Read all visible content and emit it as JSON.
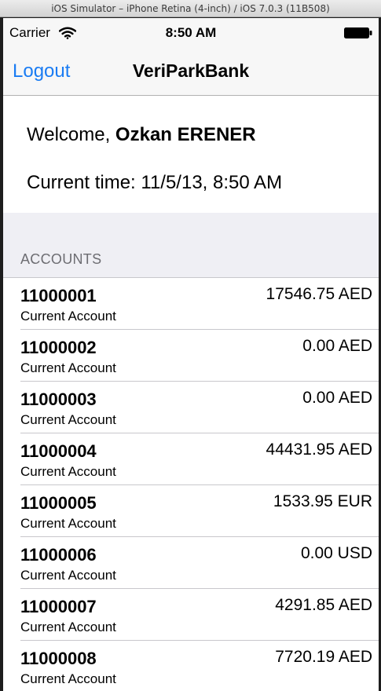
{
  "window": {
    "title": "iOS Simulator – iPhone Retina (4-inch) / iOS 7.0.3 (11B508)"
  },
  "status_bar": {
    "carrier": "Carrier",
    "wifi_icon": "wifi-icon",
    "time": "8:50 AM",
    "battery_icon": "battery-icon"
  },
  "nav": {
    "left_button": "Logout",
    "title": "VeriParkBank",
    "accent_color": "#1a7cf3"
  },
  "welcome": {
    "prefix": "Welcome, ",
    "name": "Ozkan ERENER",
    "current_time": "Current time: 11/5/13, 8:50 AM"
  },
  "accounts": {
    "section_title": "ACCOUNTS",
    "items": [
      {
        "number": "11000001",
        "type": "Current Account",
        "balance": "17546.75 AED"
      },
      {
        "number": "11000002",
        "type": "Current Account",
        "balance": "0.00 AED"
      },
      {
        "number": "11000003",
        "type": "Current Account",
        "balance": "0.00 AED"
      },
      {
        "number": "11000004",
        "type": "Current Account",
        "balance": "44431.95 AED"
      },
      {
        "number": "11000005",
        "type": "Current Account",
        "balance": "1533.95 EUR"
      },
      {
        "number": "11000006",
        "type": "Current Account",
        "balance": "0.00 USD"
      },
      {
        "number": "11000007",
        "type": "Current Account",
        "balance": "4291.85 AED"
      },
      {
        "number": "11000008",
        "type": "Current Account",
        "balance": "7720.19 AED"
      }
    ]
  }
}
